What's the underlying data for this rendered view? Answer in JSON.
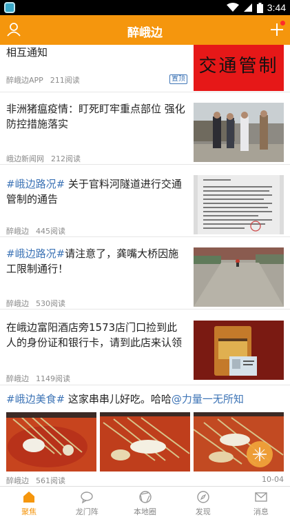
{
  "status_bar": {
    "time": "3:44"
  },
  "header": {
    "title": "醉峨边"
  },
  "feed": {
    "items": [
      {
        "title": "相互通知",
        "source": "醉峨边APP",
        "reads": "211阅读",
        "badge": "置顶",
        "thumb_text": "交通管制"
      },
      {
        "title": "非洲猪瘟疫情：盯死盯牢重点部位 强化防控措施落实",
        "source": "峨边新闻网",
        "reads": "212阅读"
      },
      {
        "tag": "#峨边路况#",
        "title": " 关于官料河隧道进行交通管制的通告",
        "source": "醉峨边",
        "reads": "445阅读"
      },
      {
        "tag": "#峨边路况#",
        "title": "请注意了，龚嘴大桥因施工限制通行！",
        "source": "醉峨边",
        "reads": "530阅读"
      },
      {
        "title": "在峨边富阳酒店旁1573店门口捡到此人的身份证和银行卡，请到此店来认领",
        "source": "醉峨边",
        "reads": "1149阅读"
      },
      {
        "tag": "#峨边美食#",
        "title": " 这家串串儿好吃。哈哈",
        "mention": "@力量一无所知",
        "source": "醉峨边",
        "reads": "561阅读",
        "date": "10-04"
      }
    ]
  },
  "bottom_nav": [
    {
      "label": "聚焦",
      "icon": "home-icon",
      "active": true
    },
    {
      "label": "龙门阵",
      "icon": "chat-icon"
    },
    {
      "label": "本地圈",
      "icon": "aperture-icon"
    },
    {
      "label": "发现",
      "icon": "compass-icon"
    },
    {
      "label": "消息",
      "icon": "mail-icon"
    }
  ],
  "colors": {
    "accent": "#f5960d",
    "link": "#3d74b6",
    "badge_dot": "#ff2a2a"
  }
}
